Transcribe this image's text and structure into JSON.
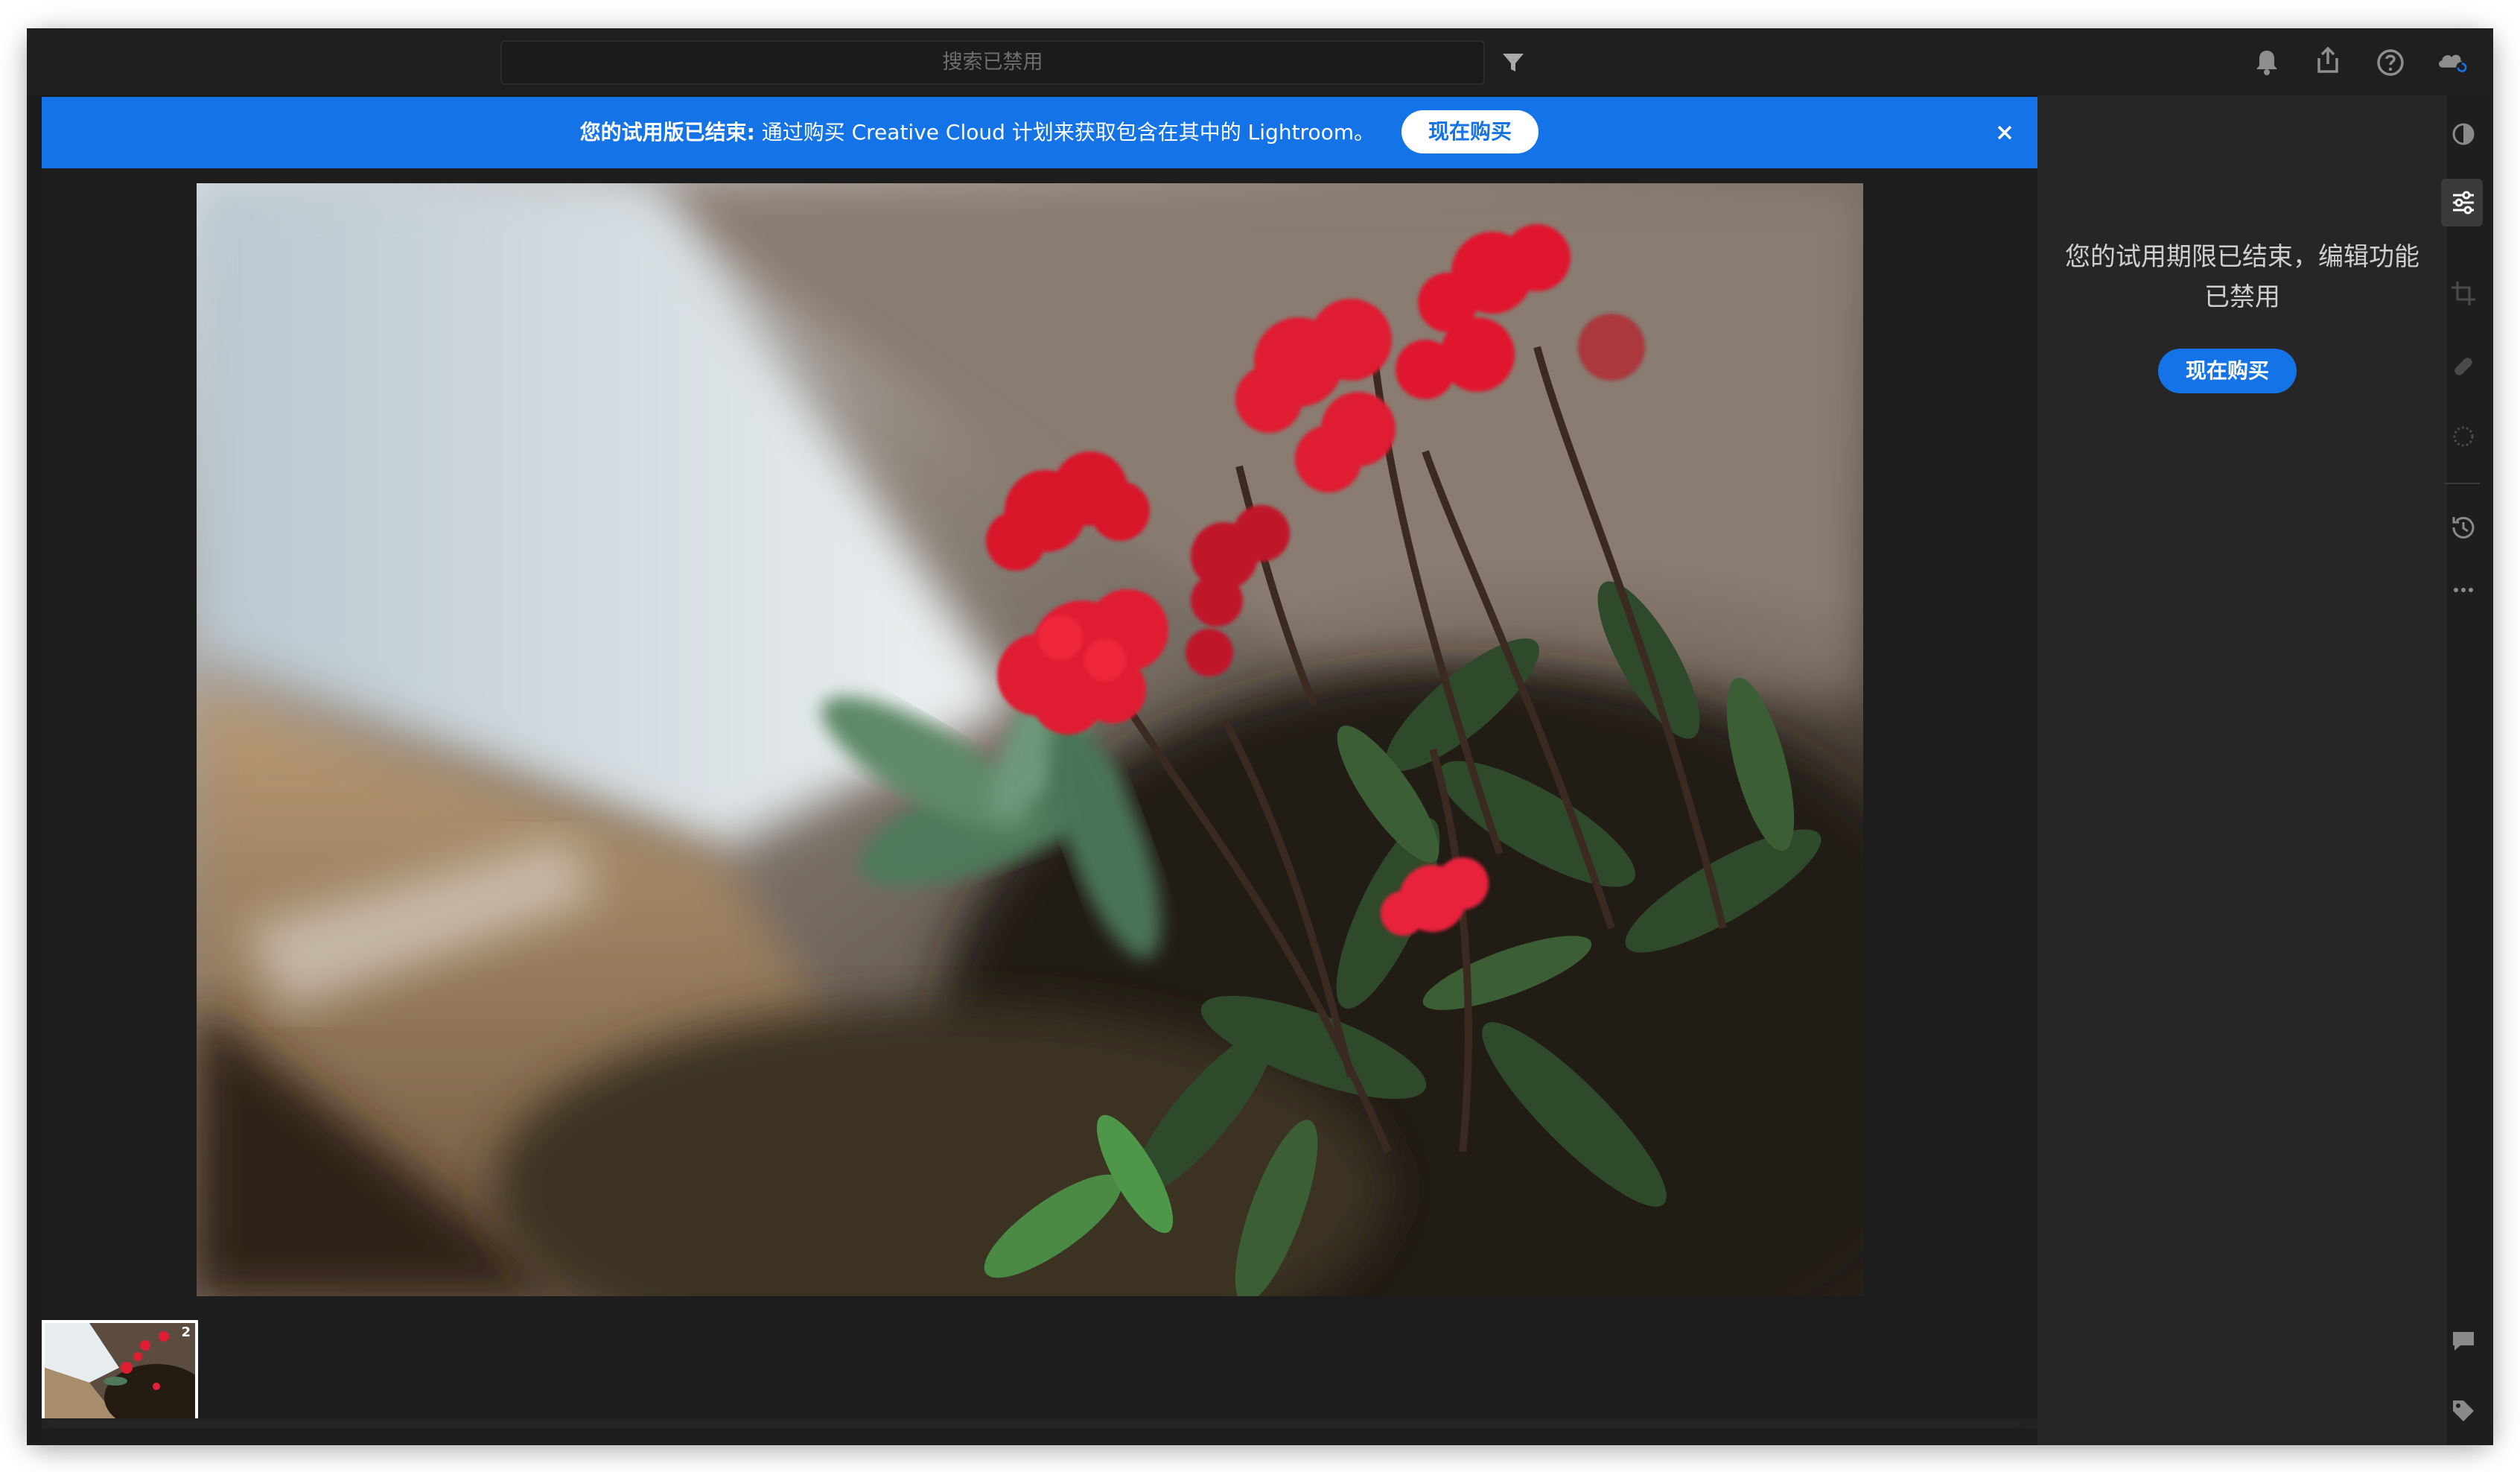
{
  "topbar": {
    "search_placeholder": "搜索已禁用",
    "icons": [
      "filter-icon",
      "bell-icon",
      "share-icon",
      "help-icon",
      "cloud-sync-icon"
    ]
  },
  "banner": {
    "bold_text": "您的试用版已结束:",
    "text": " 通过购买 Creative Cloud 计划来获取包含在其中的 Lightroom。",
    "button_label": "现在购买",
    "close_icon": "close-icon",
    "color": "#1473e6"
  },
  "photo": {
    "subject": "red kalanchoe flowers"
  },
  "filmstrip": {
    "thumbnail_badge": "2"
  },
  "right_panel": {
    "message": "您的试用期限已结束，编辑功能已禁用",
    "button_label": "现在购买"
  },
  "rail": {
    "icons": [
      "presets-icon",
      "edit-sliders-icon",
      "crop-icon",
      "healing-icon",
      "masking-icon",
      "history-icon",
      "more-icon",
      "comment-icon",
      "tag-icon"
    ],
    "selected": "edit-sliders-icon"
  },
  "colors": {
    "accent": "#1473e6",
    "background": "#1a1a1a",
    "panel": "#262626"
  }
}
